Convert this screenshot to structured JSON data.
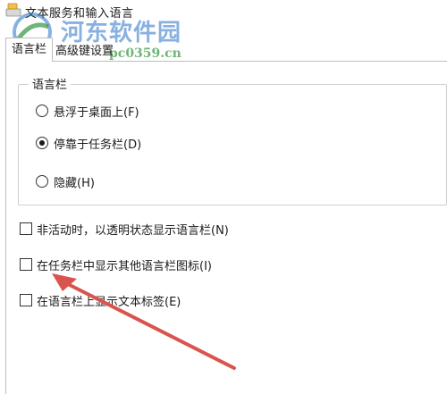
{
  "window": {
    "title": "文本服务和输入语言"
  },
  "tabs": [
    {
      "label": "语言栏",
      "active": true
    },
    {
      "label": "高级键设置",
      "active": false
    }
  ],
  "language_bar_group": {
    "legend": "语言栏",
    "options": [
      {
        "label": "悬浮于桌面上(F)",
        "selected": false
      },
      {
        "label": "停靠于任务栏(D)",
        "selected": true
      },
      {
        "label": "隐藏(H)",
        "selected": false
      }
    ]
  },
  "checkboxes": [
    {
      "label": "非活动时，以透明状态显示语言栏(N)",
      "checked": false
    },
    {
      "label": "在任务栏中显示其他语言栏图标(I)",
      "checked": false
    },
    {
      "label": "在语言栏上显示文本标签(E)",
      "checked": false
    }
  ],
  "watermark": {
    "site_name": "河东软件园",
    "url": "pc0359.cn"
  },
  "annotation": {
    "arrow_color": "#d9534f"
  }
}
